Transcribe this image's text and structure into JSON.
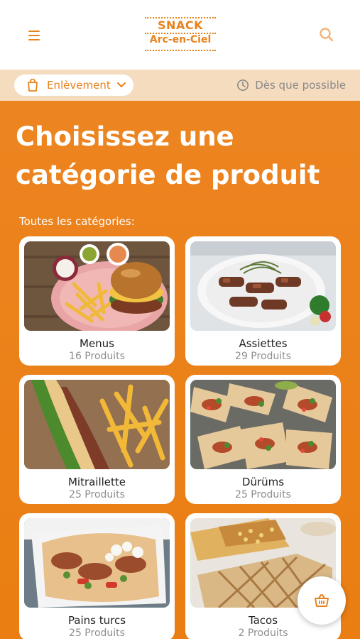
{
  "brand": {
    "line1": "SNACK",
    "line2": "Arc-en-Ciel"
  },
  "colors": {
    "accent": "#e8821c",
    "bar": "#f6dcbf",
    "background": "#ec8420"
  },
  "header": {
    "menu_icon": "menu-icon",
    "search_icon": "search-icon"
  },
  "order_bar": {
    "mode_label": "Enlèvement",
    "time_label": "Dès que possible"
  },
  "main": {
    "title": "Choisissez une catégorie de produit",
    "subtitle": "Toutes les catégories:"
  },
  "categories": [
    {
      "name": "Menus",
      "count": "16 Produits"
    },
    {
      "name": "Assiettes",
      "count": "29 Produits"
    },
    {
      "name": "Mitraillette",
      "count": "25 Produits"
    },
    {
      "name": "Dürüms",
      "count": "25 Produits"
    },
    {
      "name": "Pains turcs",
      "count": "25 Produits"
    },
    {
      "name": "Tacos",
      "count": "2 Produits"
    }
  ],
  "cart": {
    "icon": "basket-icon"
  }
}
